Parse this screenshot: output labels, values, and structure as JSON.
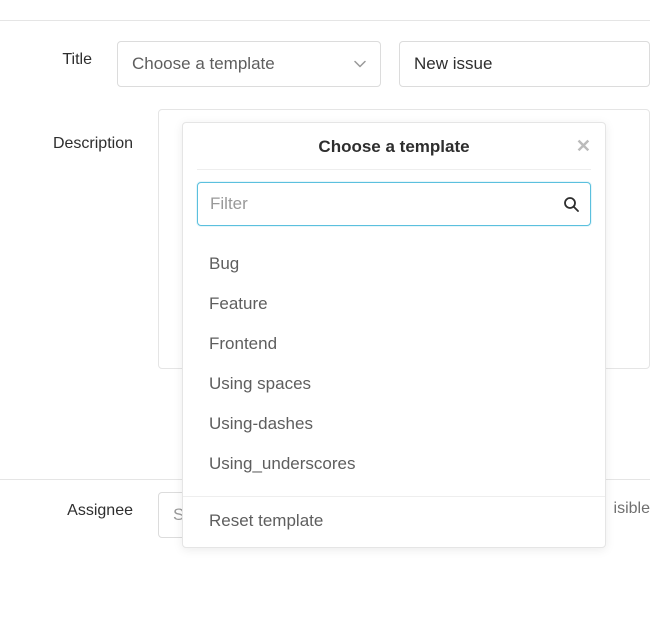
{
  "form": {
    "title_label": "Title",
    "description_label": "Description",
    "assignee_label": "Assignee",
    "template_button": "Choose a template",
    "new_issue_value": "New issue",
    "assignee_placeholder": "Select assignee",
    "visible_fragment": "isible"
  },
  "dropdown": {
    "header": "Choose a template",
    "filter_placeholder": "Filter",
    "items": [
      "Bug",
      "Feature",
      "Frontend",
      "Using spaces",
      "Using-dashes",
      "Using_underscores"
    ],
    "reset": "Reset template"
  }
}
